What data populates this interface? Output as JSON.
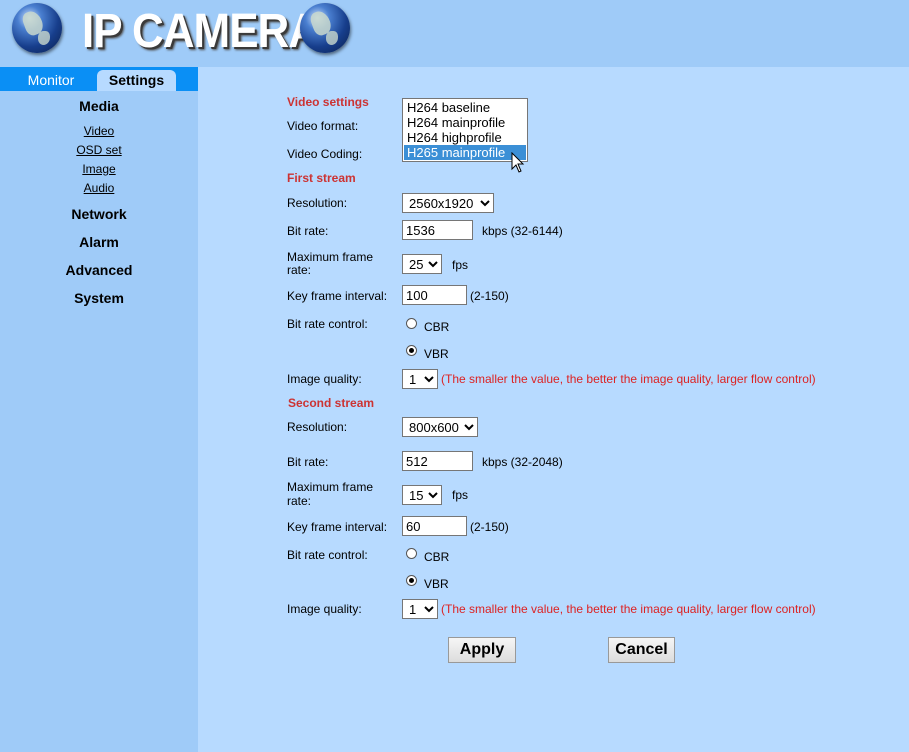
{
  "header": {
    "title": "IP CAMERA",
    "icons": [
      "globe-icon",
      "globe-icon"
    ]
  },
  "tabs": {
    "monitor": "Monitor",
    "settings": "Settings"
  },
  "sidebar": {
    "media": "Media",
    "media_items": [
      "Video",
      "OSD set",
      "Image",
      "Audio"
    ],
    "network": "Network",
    "alarm": "Alarm",
    "advanced": "Advanced",
    "system": "System"
  },
  "video_settings": {
    "title": "Video settings",
    "format_label": "Video format:",
    "coding_label": "Video Coding:",
    "coding_options": [
      "H264 baseline",
      "H264 mainprofile",
      "H264 highprofile",
      "H265 mainprofile"
    ],
    "coding_selected": "H265 mainprofile"
  },
  "first_stream": {
    "title": "First stream",
    "resolution_label": "Resolution:",
    "resolution": "2560x1920",
    "bitrate_label": "Bit rate:",
    "bitrate": "1536",
    "bitrate_hint": "kbps (32-6144)",
    "max_fps_label_1": "Maximum frame",
    "max_fps_label_2": "rate:",
    "max_fps": "25",
    "fps_unit": "fps",
    "keyframe_label": "Key frame interval:",
    "keyframe": "100",
    "keyframe_hint": "(2-150)",
    "brc_label": "Bit rate control:",
    "cbr": "CBR",
    "vbr": "VBR",
    "brc_selected": "VBR",
    "quality_label": "Image quality:",
    "quality": "1",
    "quality_note": "(The smaller the value, the better the image quality, larger flow control)"
  },
  "second_stream": {
    "title": "Second stream",
    "resolution_label": "Resolution:",
    "resolution": "800x600",
    "bitrate_label": "Bit rate:",
    "bitrate": "512",
    "bitrate_hint": "kbps (32-2048)",
    "max_fps_label_1": "Maximum frame",
    "max_fps_label_2": "rate:",
    "max_fps": "15",
    "fps_unit": "fps",
    "keyframe_label": "Key frame interval:",
    "keyframe": "60",
    "keyframe_hint": "(2-150)",
    "brc_label": "Bit rate control:",
    "cbr": "CBR",
    "vbr": "VBR",
    "brc_selected": "VBR",
    "quality_label": "Image quality:",
    "quality": "1",
    "quality_note": "(The smaller the value, the better the image quality, larger flow control)"
  },
  "actions": {
    "apply": "Apply",
    "cancel": "Cancel"
  },
  "colors": {
    "background": "#9fcbf8",
    "panel": "#b7daff",
    "tab_bar": "#0a8ff5",
    "section_title": "#cc3333",
    "note": "#dd2222",
    "highlight": "#3b8fd6"
  }
}
